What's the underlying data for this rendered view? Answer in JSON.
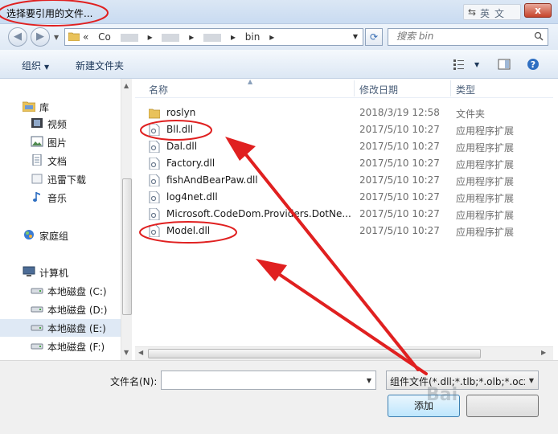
{
  "window": {
    "title": "选择要引用的文件...",
    "ime_label": "英文",
    "close_glyph": "x"
  },
  "address": {
    "crumbs": [
      "«",
      "Co",
      "bin"
    ],
    "search_placeholder": "搜索 bin"
  },
  "toolbar": {
    "organize_label": "组织",
    "new_folder_label": "新建文件夹"
  },
  "nav": {
    "items": [
      {
        "label": "库",
        "icon": "library-icon"
      },
      {
        "label": "视频",
        "icon": "video-icon"
      },
      {
        "label": "图片",
        "icon": "picture-icon"
      },
      {
        "label": "文档",
        "icon": "document-icon"
      },
      {
        "label": "迅雷下载",
        "icon": "download-icon"
      },
      {
        "label": "音乐",
        "icon": "music-icon"
      },
      {
        "label": "家庭组",
        "icon": "homegroup-icon"
      },
      {
        "label": "计算机",
        "icon": "computer-icon"
      },
      {
        "label": "本地磁盘 (C:)",
        "icon": "drive-icon"
      },
      {
        "label": "本地磁盘 (D:)",
        "icon": "drive-icon"
      },
      {
        "label": "本地磁盘 (E:)",
        "icon": "drive-icon",
        "selected": true
      },
      {
        "label": "本地磁盘 (F:)",
        "icon": "drive-icon"
      }
    ]
  },
  "files": {
    "headers": {
      "name": "名称",
      "date": "修改日期",
      "type": "类型"
    },
    "rows": [
      {
        "name": "roslyn",
        "date": "2018/3/19 12:58",
        "type": "文件夹",
        "icon": "folder-icon"
      },
      {
        "name": "Bll.dll",
        "date": "2017/5/10 10:27",
        "type": "应用程序扩展",
        "icon": "dll-file-icon"
      },
      {
        "name": "Dal.dll",
        "date": "2017/5/10 10:27",
        "type": "应用程序扩展",
        "icon": "dll-file-icon"
      },
      {
        "name": "Factory.dll",
        "date": "2017/5/10 10:27",
        "type": "应用程序扩展",
        "icon": "dll-file-icon"
      },
      {
        "name": "fishAndBearPaw.dll",
        "date": "2017/5/10 10:27",
        "type": "应用程序扩展",
        "icon": "dll-file-icon"
      },
      {
        "name": "log4net.dll",
        "date": "2017/5/10 10:27",
        "type": "应用程序扩展",
        "icon": "dll-file-icon"
      },
      {
        "name": "Microsoft.CodeDom.Providers.DotNe...",
        "date": "2017/5/10 10:27",
        "type": "应用程序扩展",
        "icon": "dll-file-icon"
      },
      {
        "name": "Model.dll",
        "date": "2017/5/10 10:27",
        "type": "应用程序扩展",
        "icon": "dll-file-icon"
      }
    ]
  },
  "bottom": {
    "filename_label": "文件名(N):",
    "filename_value": "",
    "filter_value": "组件文件(*.dll;*.tlb;*.olb;*.ocx;",
    "add_label": "添加",
    "cancel_label": "",
    "watermark": "Bai"
  },
  "colors": {
    "annotation_red": "#e02020"
  }
}
